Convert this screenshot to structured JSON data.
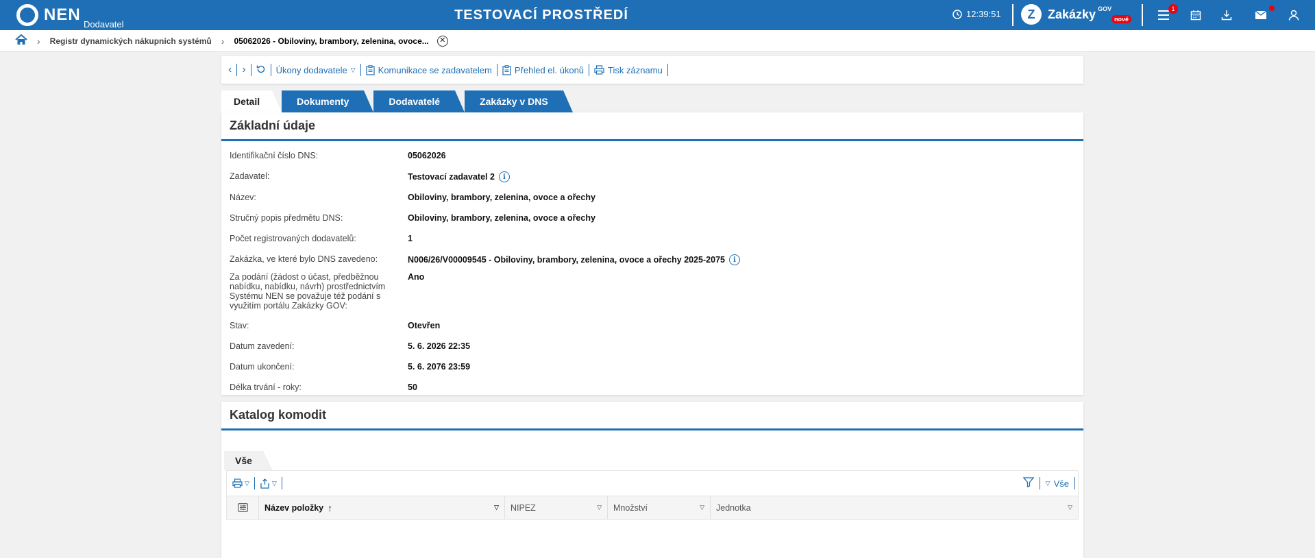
{
  "header": {
    "logo_text": "NEN",
    "logo_sub": "Dodavatel",
    "env_title": "TESTOVACÍ PROSTŘEDÍ",
    "time": "12:39:51",
    "zakazky_label": "Zakázky",
    "zakazky_gov": "GOV",
    "zakazky_new": "nové",
    "menu_badge": "1",
    "brand_color": "#1e6fb5"
  },
  "breadcrumb": {
    "item1": "Registr dynamických nákupních systémů",
    "current": "05062026 - Obiloviny, brambory, zelenina, ovoce..."
  },
  "toolbar": {
    "ukony": "Úkony dodavatele",
    "komunikace": "Komunikace se zadavatelem",
    "prehled": "Přehled el. úkonů",
    "tisk": "Tisk záznamu"
  },
  "tabs": [
    "Detail",
    "Dokumenty",
    "Dodavatelé",
    "Zakázky v DNS"
  ],
  "basic": {
    "title": "Základní údaje",
    "rows": [
      {
        "label": "Identifikační číslo DNS:",
        "value": "05062026"
      },
      {
        "label": "Zadavatel:",
        "value": "Testovací zadavatel 2"
      },
      {
        "label": "Název:",
        "value": "Obiloviny, brambory, zelenina, ovoce a ořechy"
      },
      {
        "label": "Stručný popis předmětu DNS:",
        "value": "Obiloviny, brambory, zelenina, ovoce a ořechy"
      },
      {
        "label": "Počet registrovaných dodavatelů:",
        "value": "1"
      },
      {
        "label": "Zakázka, ve které bylo DNS zavedeno:",
        "value": "N006/26/V00009545 - Obiloviny, brambory, zelenina, ovoce a ořechy 2025-2075"
      },
      {
        "label": "Za podání (žádost o účast, předběžnou nabídku, nabídku, návrh) prostřednictvím Systému NEN se považuje též podání s využitím portálu Zakázky GOV:",
        "value": "Ano"
      },
      {
        "label": "Stav:",
        "value": "Otevřen"
      },
      {
        "label": "Datum zavedení:",
        "value": "5. 6. 2026 22:35"
      },
      {
        "label": "Datum ukončení:",
        "value": "5. 6. 2076 23:59"
      },
      {
        "label": "Délka trvání - roky:",
        "value": "50"
      }
    ]
  },
  "catalog": {
    "title": "Katalog komodit",
    "subtab": "Vše",
    "filter_label": "Vše",
    "columns": [
      "Název položky",
      "NIPEZ",
      "Množství",
      "Jednotka"
    ]
  }
}
